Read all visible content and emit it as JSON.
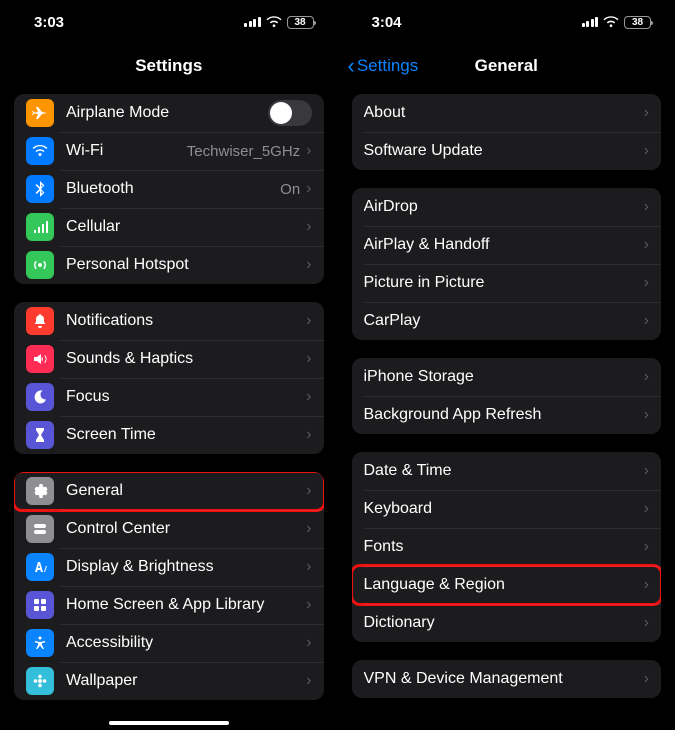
{
  "left": {
    "time": "3:03",
    "battery": "38",
    "title": "Settings",
    "groups": [
      [
        {
          "id": "airplane",
          "icon": "airplane-icon",
          "bg": "bg-orange",
          "label": "Airplane Mode",
          "toggle": true,
          "toggleOn": false
        },
        {
          "id": "wifi",
          "icon": "wifi-icon",
          "bg": "bg-blue",
          "label": "Wi-Fi",
          "detail": "Techwiser_5GHz",
          "chevron": true
        },
        {
          "id": "bluetooth",
          "icon": "bluetooth-icon",
          "bg": "bg-bt",
          "label": "Bluetooth",
          "detail": "On",
          "chevron": true
        },
        {
          "id": "cellular",
          "icon": "cellular-icon",
          "bg": "bg-green",
          "label": "Cellular",
          "chevron": true
        },
        {
          "id": "hotspot",
          "icon": "hotspot-icon",
          "bg": "bg-green2",
          "label": "Personal Hotspot",
          "chevron": true
        }
      ],
      [
        {
          "id": "notifications",
          "icon": "bell-icon",
          "bg": "bg-red",
          "label": "Notifications",
          "chevron": true
        },
        {
          "id": "sounds",
          "icon": "speaker-icon",
          "bg": "bg-pink",
          "label": "Sounds & Haptics",
          "chevron": true
        },
        {
          "id": "focus",
          "icon": "moon-icon",
          "bg": "bg-indigo",
          "label": "Focus",
          "chevron": true
        },
        {
          "id": "screentime",
          "icon": "hourglass-icon",
          "bg": "bg-purple",
          "label": "Screen Time",
          "chevron": true
        }
      ],
      [
        {
          "id": "general",
          "icon": "gear-icon",
          "bg": "bg-gray",
          "label": "General",
          "chevron": true,
          "highlight": true
        },
        {
          "id": "controlcenter",
          "icon": "switches-icon",
          "bg": "bg-gray2",
          "label": "Control Center",
          "chevron": true
        },
        {
          "id": "display",
          "icon": "text-size-icon",
          "bg": "bg-dblue",
          "label": "Display & Brightness",
          "chevron": true
        },
        {
          "id": "homescreen",
          "icon": "grid-icon",
          "bg": "bg-hs",
          "label": "Home Screen & App Library",
          "chevron": true
        },
        {
          "id": "accessibility",
          "icon": "accessibility-icon",
          "bg": "bg-acc",
          "label": "Accessibility",
          "chevron": true
        },
        {
          "id": "wallpaper",
          "icon": "flower-icon",
          "bg": "bg-wall",
          "label": "Wallpaper",
          "chevron": true
        }
      ]
    ]
  },
  "right": {
    "time": "3:04",
    "battery": "38",
    "back": "Settings",
    "title": "General",
    "groups": [
      [
        {
          "id": "about",
          "label": "About",
          "chevron": true
        },
        {
          "id": "software-update",
          "label": "Software Update",
          "chevron": true
        }
      ],
      [
        {
          "id": "airdrop",
          "label": "AirDrop",
          "chevron": true
        },
        {
          "id": "airplay",
          "label": "AirPlay & Handoff",
          "chevron": true
        },
        {
          "id": "pip",
          "label": "Picture in Picture",
          "chevron": true
        },
        {
          "id": "carplay",
          "label": "CarPlay",
          "chevron": true
        }
      ],
      [
        {
          "id": "storage",
          "label": "iPhone Storage",
          "chevron": true
        },
        {
          "id": "bg-refresh",
          "label": "Background App Refresh",
          "chevron": true
        }
      ],
      [
        {
          "id": "date-time",
          "label": "Date & Time",
          "chevron": true
        },
        {
          "id": "keyboard",
          "label": "Keyboard",
          "chevron": true
        },
        {
          "id": "fonts",
          "label": "Fonts",
          "chevron": true
        },
        {
          "id": "language-region",
          "label": "Language & Region",
          "chevron": true,
          "highlight": true
        },
        {
          "id": "dictionary",
          "label": "Dictionary",
          "chevron": true
        }
      ],
      [
        {
          "id": "vpn",
          "label": "VPN & Device Management",
          "chevron": true
        }
      ]
    ]
  }
}
